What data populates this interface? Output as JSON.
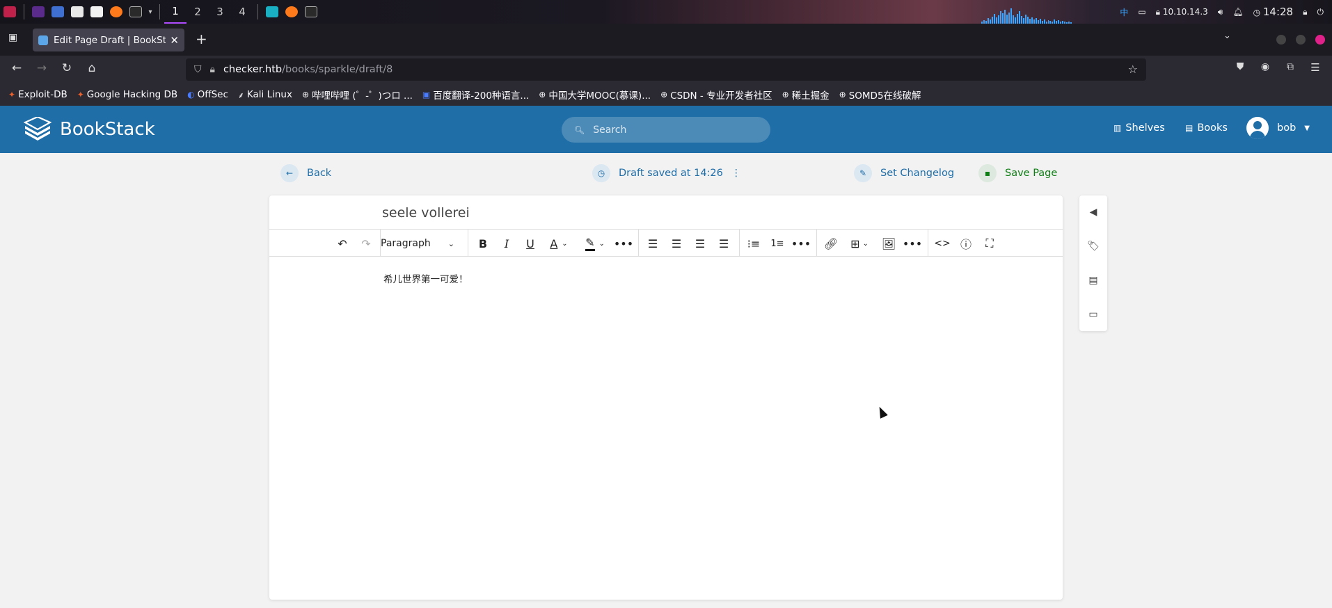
{
  "taskbar": {
    "workspaces": [
      "1",
      "2",
      "3",
      "4"
    ],
    "ip": "10.10.14.3",
    "clock": "14:28",
    "ime": "中"
  },
  "browser": {
    "tab_title": "Edit Page Draft | BookStack",
    "url_host": "checker.htb",
    "url_path": "/books/sparkle/draft/8",
    "bookmarks": [
      "Exploit-DB",
      "Google Hacking DB",
      "OffSec",
      "Kali Linux",
      "哔哩哔哩 (゜-゜)つロ ...",
      "百度翻译-200种语言...",
      "中国大学MOOC(慕课)...",
      "CSDN - 专业开发者社区",
      "稀土掘金",
      "SOMD5在线破解"
    ]
  },
  "app": {
    "name": "BookStack",
    "search_placeholder": "Search",
    "nav": {
      "shelves": "Shelves",
      "books": "Books"
    },
    "user": "bob"
  },
  "actions": {
    "back": "Back",
    "draft_status": "Draft saved at 14:26",
    "changelog": "Set Changelog",
    "save": "Save Page"
  },
  "editor": {
    "page_title": "seele vollerei",
    "block_format": "Paragraph",
    "body": "希儿世界第一可爱！"
  },
  "icons": {
    "primary_color": "#206ea7",
    "save_color": "#0f7d15"
  }
}
